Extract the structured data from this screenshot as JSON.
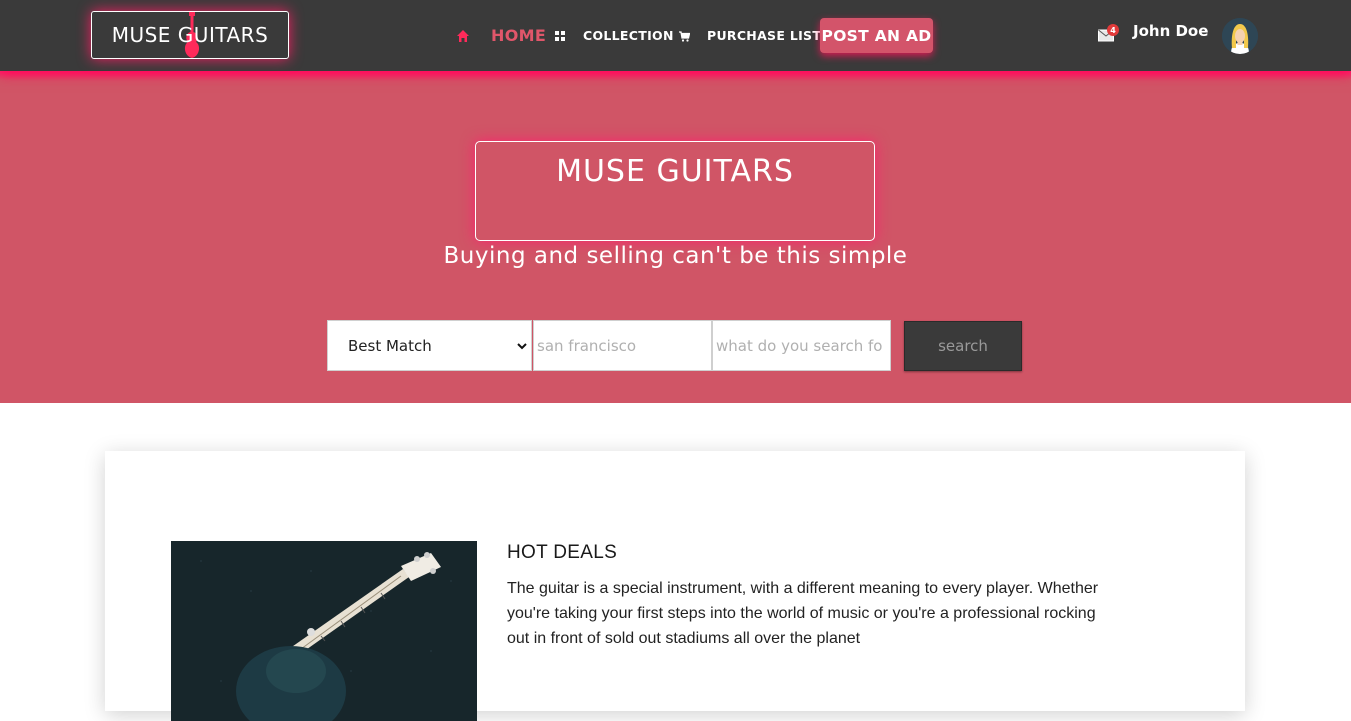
{
  "brand": {
    "logo_text": "MUSE GUITARS"
  },
  "nav": {
    "home": "HOME",
    "collection": "COLLECTION",
    "purchase_list": "PURCHASE LIST",
    "post_ad": "POST AN AD"
  },
  "user": {
    "name": "John Doe",
    "unread_messages": "4"
  },
  "hero": {
    "title": "MUSE GUITARS",
    "subtitle": "Buying and selling can't be this simple"
  },
  "search": {
    "sort_selected": "Best Match",
    "location_placeholder": "san francisco",
    "query_placeholder": "what do you search fo",
    "button_label": "search"
  },
  "deals": {
    "title": "HOT DEALS",
    "text": "The guitar is a special instrument, with a different meaning to every player. Whether you're taking your first steps into the world of music or you're a professional rocking out in front of sold out stadiums all over the planet"
  },
  "colors": {
    "topbar": "#3a3a3a",
    "accent": "#d05566",
    "glow": "#ff1f67",
    "home_active": "#e0566a"
  },
  "icons": [
    "guitar-logo-icon",
    "home-icon",
    "grid-icon",
    "cart-icon",
    "mail-icon",
    "chevron-down-icon"
  ]
}
